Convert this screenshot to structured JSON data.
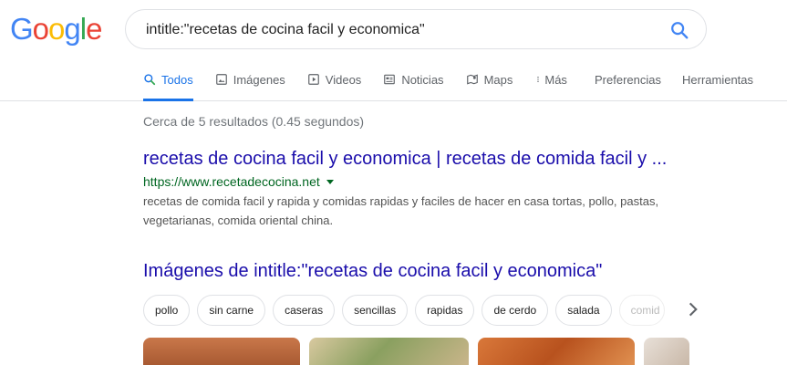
{
  "logo": {
    "letters": [
      "G",
      "o",
      "o",
      "g",
      "l",
      "e"
    ],
    "colors": [
      "#4285F4",
      "#EA4335",
      "#FBBC05",
      "#4285F4",
      "#34A853",
      "#EA4335"
    ]
  },
  "search": {
    "query": "intitle:\"recetas de cocina facil y economica\""
  },
  "tabs": [
    {
      "label": "Todos",
      "icon": "search-icon",
      "active": true
    },
    {
      "label": "Imágenes",
      "icon": "image-icon"
    },
    {
      "label": "Videos",
      "icon": "video-icon"
    },
    {
      "label": "Noticias",
      "icon": "news-icon"
    },
    {
      "label": "Maps",
      "icon": "map-icon"
    },
    {
      "label": "Más",
      "icon": "more-vert-icon"
    }
  ],
  "tools": {
    "preferences": "Preferencias",
    "tools": "Herramientas"
  },
  "stats": "Cerca de 5 resultados (0.45 segundos)",
  "result": {
    "title": "recetas de cocina facil y economica | recetas de comida facil y ...",
    "url": "https://www.recetadecocina.net",
    "snippet": "recetas de comida facil y rapida y comidas rapidas y faciles de hacer en casa tortas, pollo, pastas, vegetarianas, comida oriental china."
  },
  "images": {
    "heading": "Imágenes de intitle:\"recetas de cocina facil y economica\"",
    "chips": [
      "pollo",
      "sin carne",
      "caseras",
      "sencillas",
      "rapidas",
      "de cerdo",
      "salada",
      "comid"
    ]
  },
  "colors": {
    "accent": "#1a73e8",
    "link": "#1a0dab",
    "url": "#006621"
  }
}
